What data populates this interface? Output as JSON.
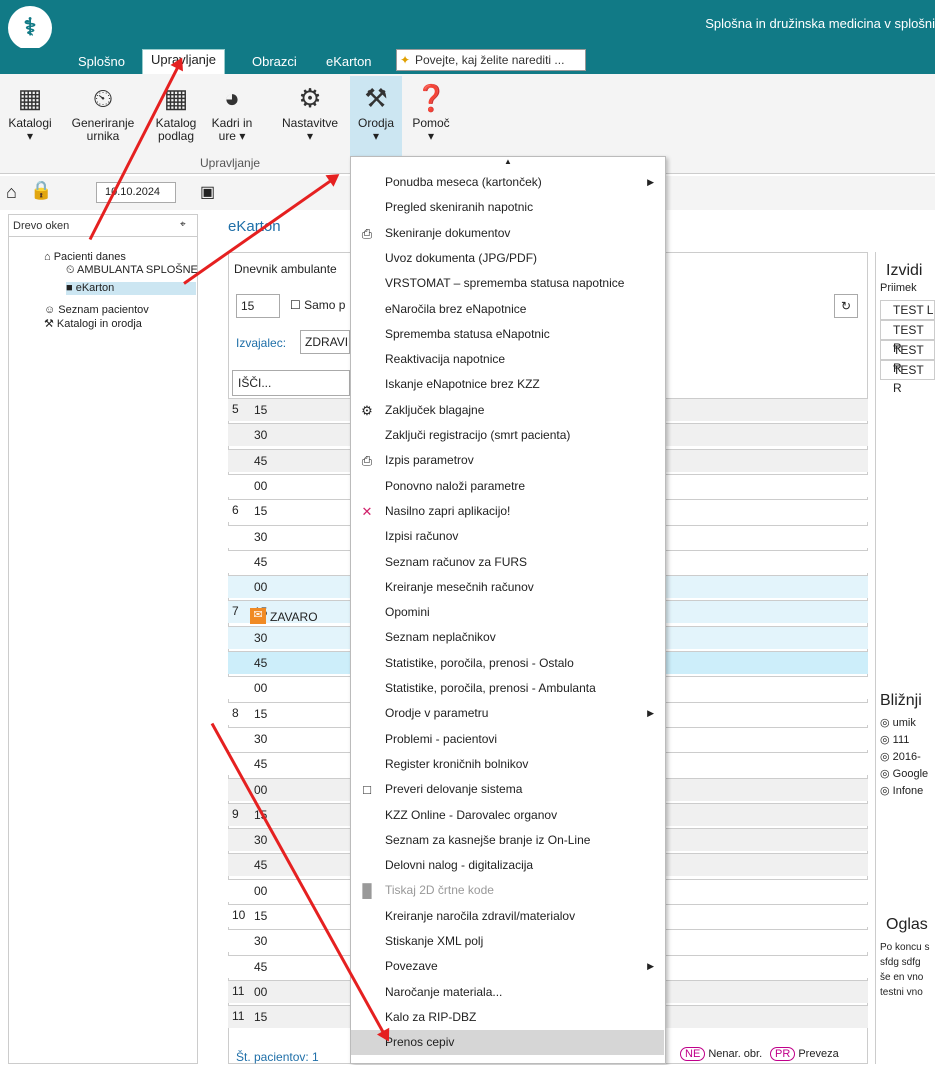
{
  "app": {
    "title": "Splošna in družinska medicina v splošni",
    "logo": "stethoscope-icon",
    "accent": "#117a86"
  },
  "tabs": [
    "Splošno",
    "Upravljanje",
    "Obrazci",
    "eKarton"
  ],
  "tellme": "Povejte, kaj želite narediti ...",
  "ribbon": {
    "buttons": [
      {
        "label": "Katalogi",
        "icon": "catalog-icon"
      },
      {
        "label": "Generiranje urnika",
        "icon": "schedule-icon"
      },
      {
        "label": "Katalog podlag",
        "icon": "grid-icon"
      },
      {
        "label": "Kadri in ure",
        "icon": "staff-icon"
      },
      {
        "label": "Nastavitve",
        "icon": "gear-icon"
      },
      {
        "label": "Orodja",
        "icon": "tools-icon"
      },
      {
        "label": "Pomoč",
        "icon": "help-icon"
      }
    ],
    "group": "Upravljanje"
  },
  "quick": {
    "date": "10.10.2024"
  },
  "left": {
    "header": "Drevo oken",
    "items": [
      "Pacienti danes",
      "AMBULANTA SPLOŠNE",
      "eKarton",
      "Seznam pacientov",
      "Katalogi in orodja"
    ]
  },
  "main": {
    "title": "eKarton",
    "tab": "Dnevnik ambulante",
    "count": "15",
    "only_label": "Samo p",
    "provider_label": "Izvajalec:",
    "provider": "ZDRAVI",
    "search": "IŠČI...",
    "footer": "Št. pacientov: 1",
    "legend": [
      {
        "badge": "NE",
        "label": "Nenar. obr."
      },
      {
        "badge": "PR",
        "label": "Preveza"
      }
    ],
    "patient": "ZAVARO"
  },
  "hours": [
    "5",
    "6",
    "7",
    "8",
    "9",
    "10",
    "11"
  ],
  "right": {
    "izvidi": "Izvidi",
    "col": "Priimek",
    "rows": [
      "TEST L",
      "TEST R",
      "TEST R",
      "TEST R"
    ],
    "blizn": "Bližnji",
    "links": [
      "umik",
      "111",
      "2016-",
      "Google",
      "Infone"
    ],
    "oglas": "Oglas",
    "oglas_text": [
      "Po koncu s",
      "sfdg sdfg",
      "še en vno",
      "testni vno"
    ]
  },
  "menu": [
    {
      "label": "Ponudba meseca (kartonček)",
      "sub": true
    },
    {
      "label": "Pregled skeniranih napotnic"
    },
    {
      "label": "Skeniranje dokumentov",
      "icon": "scanner-icon"
    },
    {
      "label": "Uvoz dokumenta (JPG/PDF)"
    },
    {
      "label": "VRSTOMAT – sprememba statusa napotnice"
    },
    {
      "label": "eNaročila brez eNapotnice"
    },
    {
      "label": "Sprememba statusa eNapotnic"
    },
    {
      "label": "Reaktivacija napotnice"
    },
    {
      "label": "Iskanje eNapotnice brez KZZ"
    },
    {
      "label": "Zaključek blagajne",
      "icon": "gear-icon"
    },
    {
      "label": "Zaključi registracijo (smrt pacienta)"
    },
    {
      "label": "Izpis parametrov",
      "icon": "printer-icon"
    },
    {
      "label": "Ponovno naloži parametre"
    },
    {
      "label": "Nasilno zapri aplikacijo!",
      "icon": "close-icon"
    },
    {
      "label": "Izpisi računov"
    },
    {
      "label": "Seznam računov za FURS"
    },
    {
      "label": "Kreiranje mesečnih računov"
    },
    {
      "label": "Opomini"
    },
    {
      "label": "Seznam neplačnikov"
    },
    {
      "label": "Statistike, poročila, prenosi - Ostalo"
    },
    {
      "label": "Statistike, poročila, prenosi - Ambulanta"
    },
    {
      "label": "Orodje v parametru",
      "sub": true
    },
    {
      "label": "Problemi - pacientovi"
    },
    {
      "label": "Register kroničnih bolnikov"
    },
    {
      "label": "Preveri delovanje sistema",
      "icon": "monitor-icon"
    },
    {
      "label": "KZZ Online - Darovalec organov"
    },
    {
      "label": "Seznam za kasnejše branje iz On-Line"
    },
    {
      "label": "Delovni nalog - digitalizacija"
    },
    {
      "label": "Tiskaj 2D črtne kode",
      "disabled": true,
      "icon": "barcode-icon"
    },
    {
      "label": "Kreiranje naročila zdravil/materialov"
    },
    {
      "label": "Stiskanje XML polj"
    },
    {
      "label": "Povezave",
      "sub": true
    },
    {
      "label": "Naročanje materiala..."
    },
    {
      "label": "Kalo za RIP-DBZ"
    },
    {
      "label": "Prenos cepiv",
      "highlight": true
    }
  ]
}
